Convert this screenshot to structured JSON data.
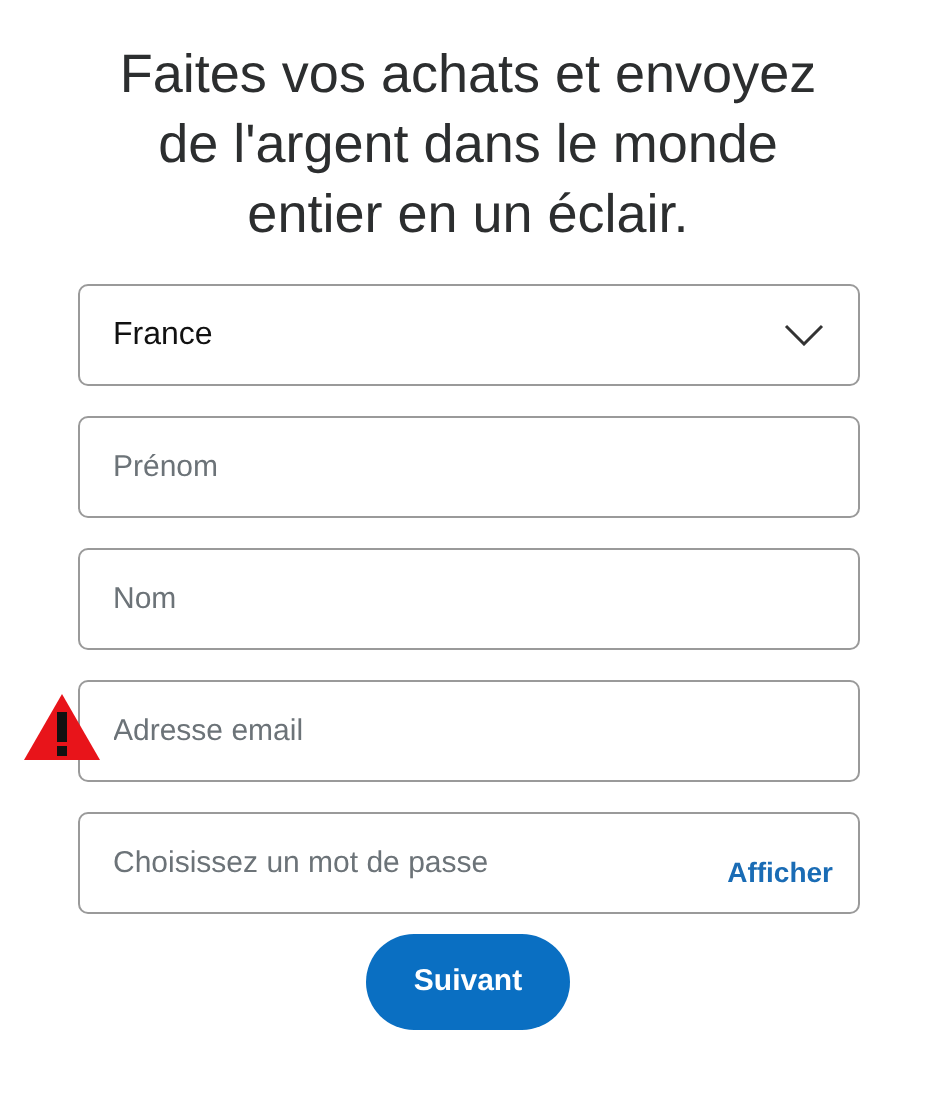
{
  "heading": "Faites vos achats et envoyez de l'argent dans le monde entier en un éclair.",
  "fields": [
    {
      "kind": "select",
      "value": "France"
    },
    {
      "kind": "text",
      "placeholder": "Prénom",
      "error": false
    },
    {
      "kind": "text",
      "placeholder": "Nom",
      "error": false
    },
    {
      "kind": "email",
      "placeholder": "Adresse email",
      "error": true
    },
    {
      "kind": "password",
      "placeholder": "Choisissez un mot de passe",
      "action": "Afficher",
      "error": false
    }
  ],
  "submit": "Suivant"
}
